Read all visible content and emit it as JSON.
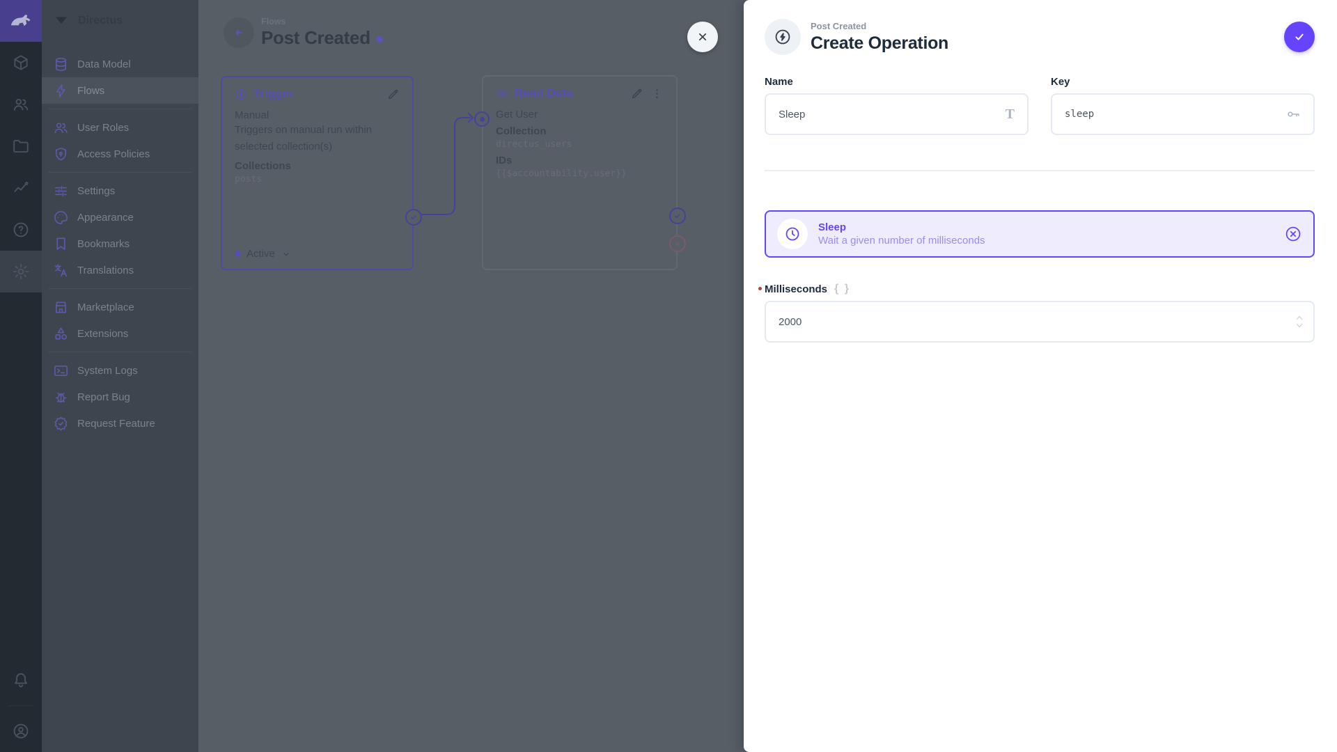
{
  "colors": {
    "accent": "#6644ff",
    "flow_status_dot": "#5b51c9"
  },
  "module_bar": {
    "logo_icon": "rabbit-icon",
    "modules": [
      "data-model",
      "user-directory",
      "file-library",
      "insights",
      "help"
    ],
    "active_module": "settings",
    "bottom_icons": [
      "notifications",
      "profile"
    ]
  },
  "sidebar": {
    "project_name": "Directus",
    "items": [
      {
        "label": "Data Model"
      },
      {
        "label": "Flows",
        "active": true
      },
      {
        "label": "User Roles"
      },
      {
        "label": "Access Policies"
      },
      {
        "label": "Settings"
      },
      {
        "label": "Appearance"
      },
      {
        "label": "Bookmarks"
      },
      {
        "label": "Translations"
      },
      {
        "label": "Marketplace"
      },
      {
        "label": "Extensions"
      },
      {
        "label": "System Logs"
      },
      {
        "label": "Report Bug"
      },
      {
        "label": "Request Feature"
      }
    ]
  },
  "flow": {
    "breadcrumb": "Flows",
    "title": "Post Created",
    "trigger_panel": {
      "type_label": "Trigger",
      "name": "Manual",
      "description": "Triggers on manual run within selected collection(s)",
      "field_label": "Collections",
      "field_value": "posts",
      "status_label": "Active"
    },
    "operation_panel": {
      "type_label": "Read Data",
      "name": "Get User",
      "field1_label": "Collection",
      "field1_value": "directus_users",
      "field2_label": "IDs",
      "field2_value": "{{$accountability.user}}"
    }
  },
  "drawer": {
    "breadcrumb": "Post Created",
    "title": "Create Operation",
    "name_field": {
      "label": "Name",
      "value": "Sleep"
    },
    "key_field": {
      "label": "Key",
      "value": "sleep"
    },
    "selected_operation": {
      "name": "Sleep",
      "description": "Wait a given number of milliseconds"
    },
    "milliseconds_field": {
      "label": "Milliseconds",
      "value": "2000"
    }
  }
}
